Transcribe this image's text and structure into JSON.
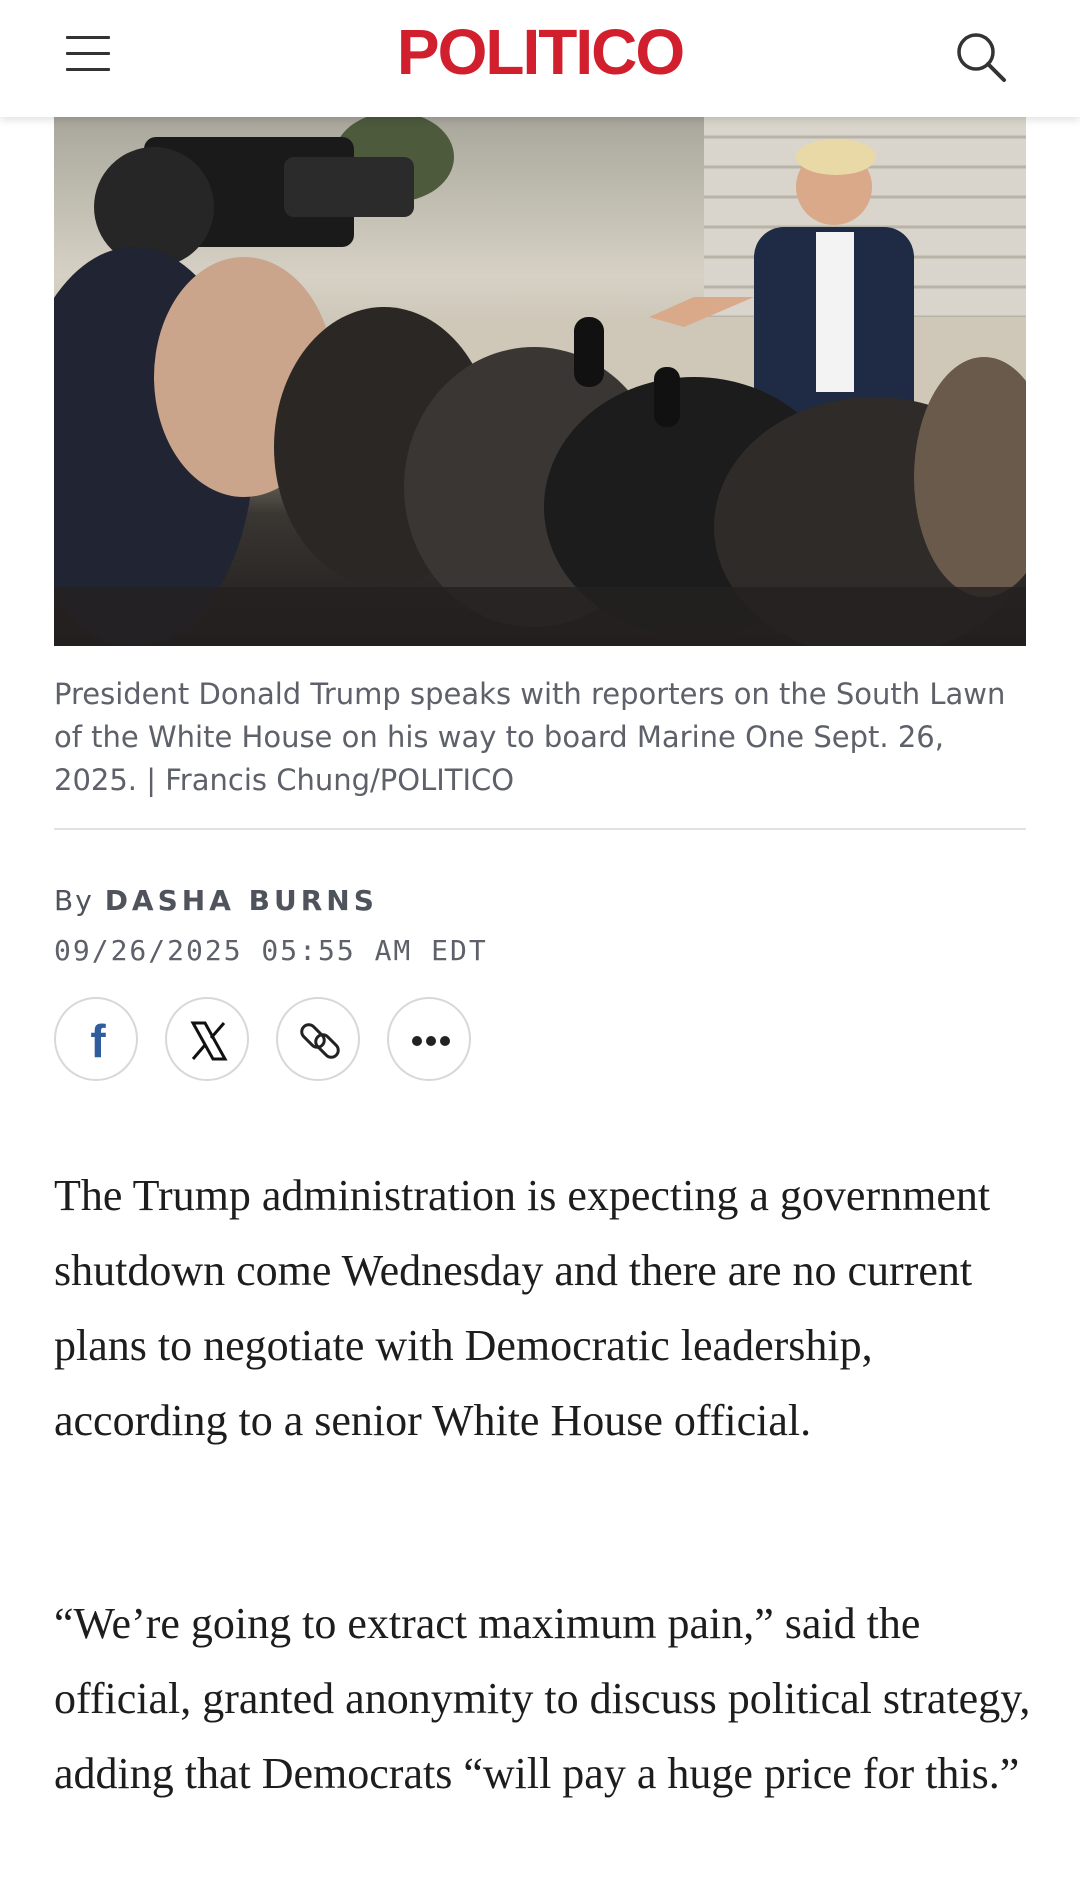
{
  "header": {
    "logo_text": "POLITICO",
    "menu_icon": "hamburger-menu-icon",
    "search_icon": "search-icon",
    "brand_color": "#d11f2e"
  },
  "article": {
    "image_alt": "President Donald Trump speaks with reporters on the South Lawn",
    "caption": "President Donald Trump speaks with reporters on the South Lawn of the White House on his way to board Marine One Sept. 26, 2025. | Francis Chung/POLITICO",
    "byline_prefix": "By",
    "author": "DASHA BURNS",
    "timestamp": "09/26/2025 05:55 AM EDT",
    "share": {
      "facebook_icon": "facebook-icon",
      "x_icon": "x-icon",
      "link_icon": "link-icon",
      "more_icon": "more-icon"
    },
    "paragraphs": [
      "The Trump administration is expecting a government shutdown come Wednesday and there are no current plans to negotiate with Democratic leadership, according to a senior White House official.",
      "“We’re going to extract maximum pain,” said the official, granted anonymity to discuss political strategy, adding that Democrats “will pay a huge price for this.”"
    ]
  }
}
